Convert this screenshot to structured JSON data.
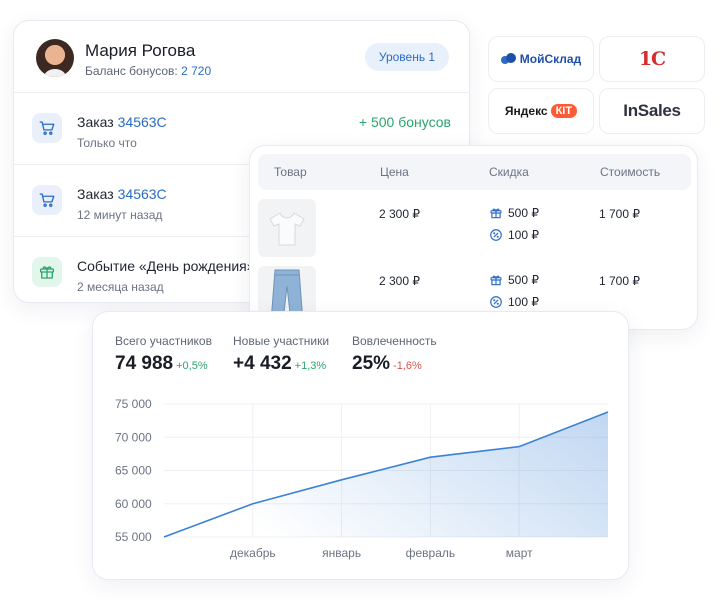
{
  "profile": {
    "name": "Мария Рогова",
    "balance_label": "Баланс бонусов:",
    "balance_value": "2 720",
    "level": "Уровень 1",
    "events": [
      {
        "title": "Заказ",
        "link": "34563С",
        "subtitle": "Только что",
        "bonus": "+ 500 бонусов",
        "icon": "cart-icon"
      },
      {
        "title": "Заказ",
        "link": "34563С",
        "subtitle": "12 минут назад",
        "bonus": "",
        "icon": "cart-icon"
      },
      {
        "title": "Событие «День рождения»",
        "link": "",
        "subtitle": "2 месяца назад",
        "bonus": "",
        "icon": "gift-icon"
      }
    ]
  },
  "logos": {
    "moysklad": "МойСклад",
    "onec": "1С",
    "yandex": "Яндекс",
    "kit": "КIT",
    "insales": "InSales"
  },
  "products": {
    "headers": {
      "item": "Товар",
      "price": "Цена",
      "discount": "Скидка",
      "cost": "Стоимость"
    },
    "rows": [
      {
        "image": "tshirt",
        "price": "2 300 ₽",
        "bonus_discount": "500 ₽",
        "coupon_discount": "100 ₽",
        "cost": "1 700 ₽"
      },
      {
        "image": "jeans",
        "price": "2 300 ₽",
        "bonus_discount": "500 ₽",
        "coupon_discount": "100 ₽",
        "cost": "1 700 ₽"
      }
    ]
  },
  "stats": {
    "total": {
      "label": "Всего участников",
      "value": "74 988",
      "delta": "+0,5%"
    },
    "new": {
      "label": "Новые участники",
      "value": "+4 432",
      "delta": "+1,3%"
    },
    "engagement": {
      "label": "Вовлеченность",
      "value": "25%",
      "delta": "-1,6%"
    }
  },
  "colors": {
    "accent": "#2b6cc4",
    "positive": "#2aa56b",
    "negative": "#d9534f",
    "line": "#3b82d6"
  },
  "chart_data": {
    "type": "area",
    "categories": [
      "",
      "декабрь",
      "январь",
      "февраль",
      "март",
      ""
    ],
    "values": [
      55000,
      60000,
      63600,
      67000,
      68600,
      73800
    ],
    "ylim": [
      55000,
      75000
    ],
    "yticks": [
      "75 000",
      "70 000",
      "65 000",
      "60 000",
      "55 000"
    ],
    "ytick_values": [
      75000,
      70000,
      65000,
      60000,
      55000
    ],
    "grid": true
  }
}
